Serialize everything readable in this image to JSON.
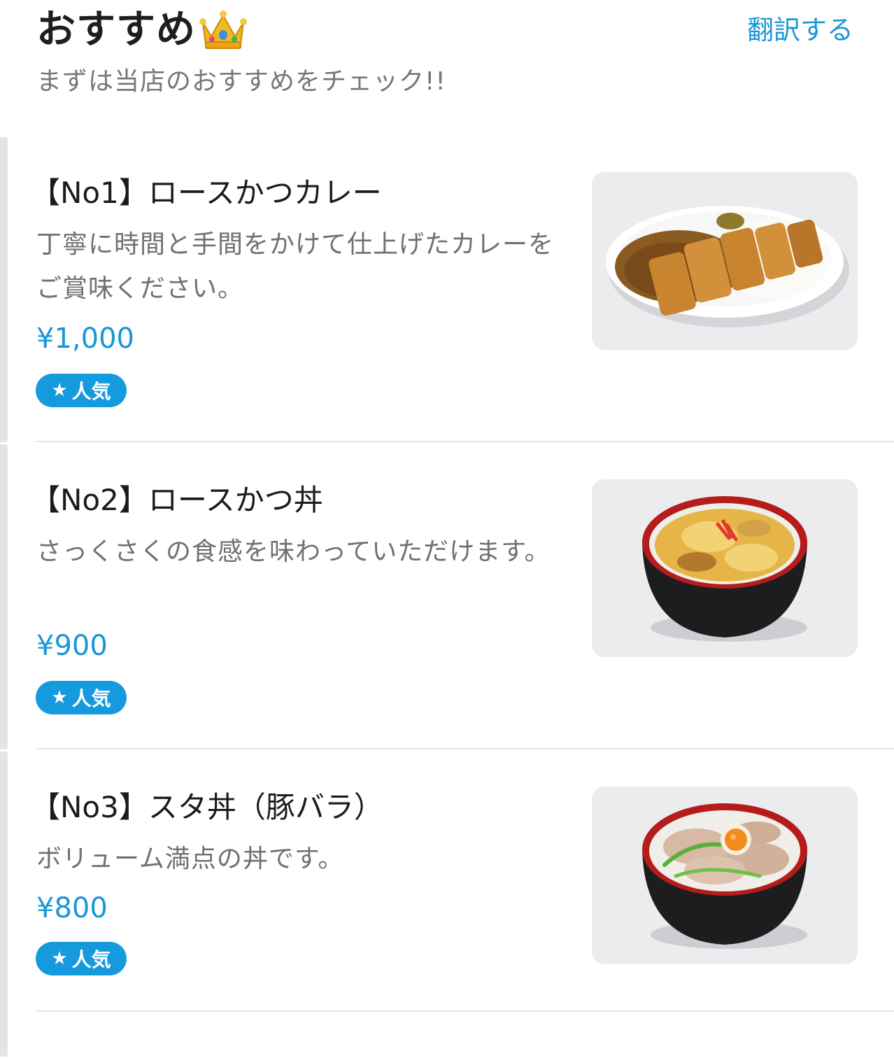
{
  "header": {
    "title": "おすすめ",
    "crown_emoji": "crown-icon",
    "translate_label": "翻訳する",
    "subtitle": "まずは当店のおすすめをチェック!!"
  },
  "items": [
    {
      "name": "【No1】ロースかつカレー",
      "description": "丁寧に時間と手間をかけて仕上げたカレーをご賞味ください。",
      "price": "¥1,000",
      "badge": "人気",
      "photo": "katsu-curry-photo"
    },
    {
      "name": "【No2】ロースかつ丼",
      "description": "さっくさくの食感を味わっていただけます。",
      "price": "¥900",
      "badge": "人気",
      "photo": "katsudon-photo"
    },
    {
      "name": "【No3】スタ丼（豚バラ）",
      "description": "ボリューム満点の丼です。",
      "price": "¥800",
      "badge": "人気",
      "photo": "sutadon-photo"
    }
  ],
  "colors": {
    "accent": "#1a97d6",
    "badge": "#159ade",
    "text": "#1b1b1b",
    "muted": "#707070",
    "divider": "#e2e2e2"
  }
}
